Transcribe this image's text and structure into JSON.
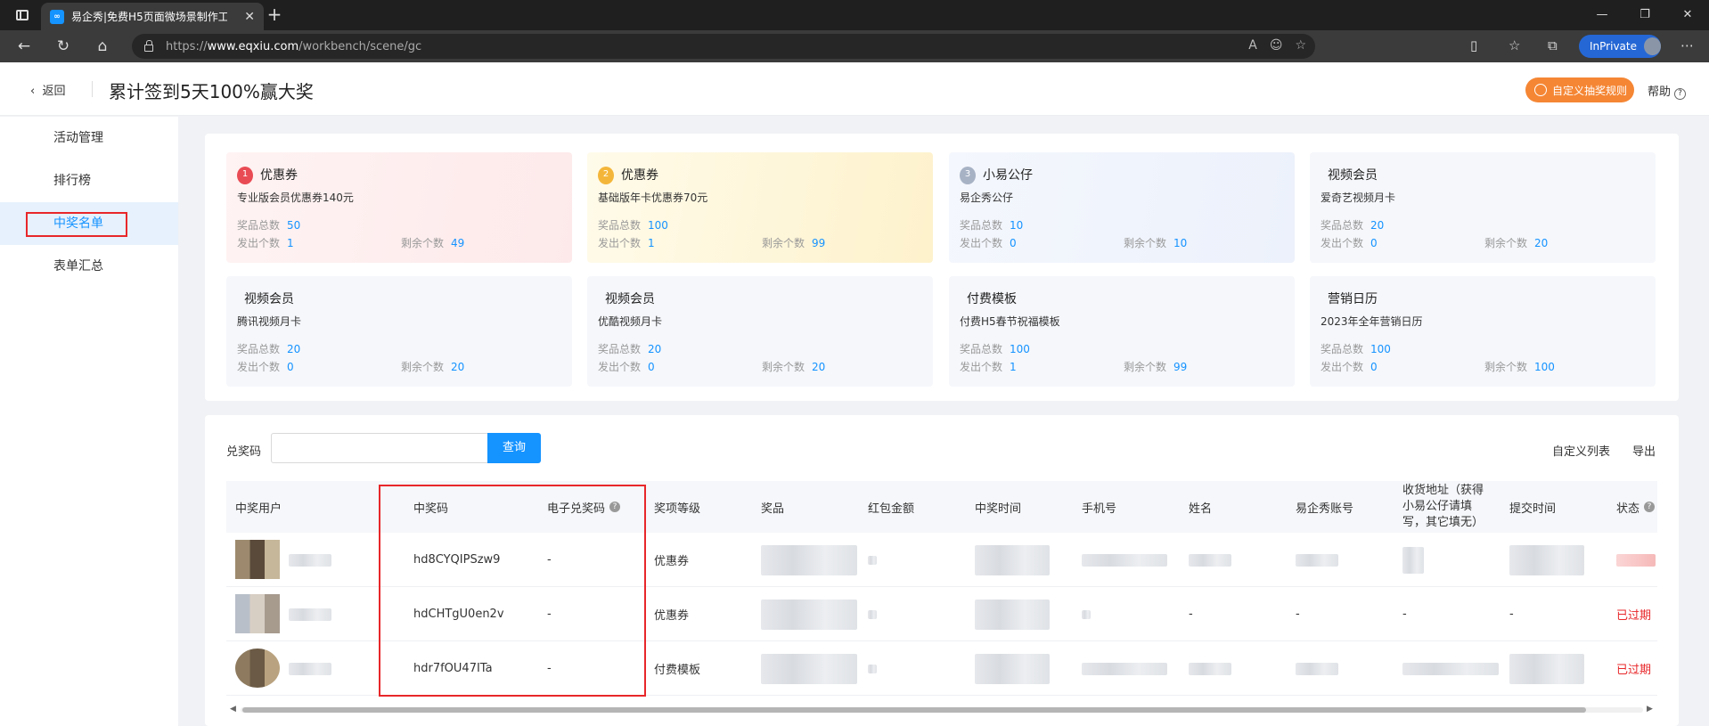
{
  "browser": {
    "tab_title": "易企秀|免费H5页面微场景制作工",
    "url_prefix": "https://",
    "url_domain": "www.eqxiu.com",
    "url_path": "/workbench/scene/gc",
    "inprivate": "InPrivate"
  },
  "header": {
    "back": "返回",
    "title": "累计签到5天100%赢大奖",
    "rule_button": "自定义抽奖规则",
    "help": "帮助"
  },
  "sidebar": {
    "items": [
      "活动管理",
      "排行榜",
      "中奖名单",
      "表单汇总"
    ]
  },
  "prize_labels": {
    "total": "奖品总数",
    "issued": "发出个数",
    "remaining": "剩余个数"
  },
  "prizes": [
    {
      "rank": "1",
      "name": "优惠券",
      "desc": "专业版会员优惠券140元",
      "total": "50",
      "issued": "1",
      "remaining": "49"
    },
    {
      "rank": "2",
      "name": "优惠券",
      "desc": "基础版年卡优惠券70元",
      "total": "100",
      "issued": "1",
      "remaining": "99"
    },
    {
      "rank": "3",
      "name": "小易公仔",
      "desc": "易企秀公仔",
      "total": "10",
      "issued": "0",
      "remaining": "10"
    },
    {
      "rank": "",
      "name": "视频会员",
      "desc": "爱奇艺视频月卡",
      "total": "20",
      "issued": "0",
      "remaining": "20"
    },
    {
      "rank": "",
      "name": "视频会员",
      "desc": "腾讯视频月卡",
      "total": "20",
      "issued": "0",
      "remaining": "20"
    },
    {
      "rank": "",
      "name": "视频会员",
      "desc": "优酷视频月卡",
      "total": "20",
      "issued": "0",
      "remaining": "20"
    },
    {
      "rank": "",
      "name": "付费模板",
      "desc": "付费H5春节祝福模板",
      "total": "100",
      "issued": "1",
      "remaining": "99"
    },
    {
      "rank": "",
      "name": "营销日历",
      "desc": "2023年全年营销日历",
      "total": "100",
      "issued": "0",
      "remaining": "100"
    }
  ],
  "search": {
    "label": "兑奖码",
    "button": "查询",
    "placeholder": ""
  },
  "table_actions": {
    "custom_columns": "自定义列表",
    "export": "导出"
  },
  "table": {
    "columns": [
      "中奖用户",
      "中奖码",
      "电子兑奖码",
      "奖项等级",
      "奖品",
      "红包金额",
      "中奖时间",
      "手机号",
      "姓名",
      "易企秀账号",
      "收货地址（获得小易公仔请填写，其它填无）",
      "提交时间",
      "状态"
    ],
    "rows": [
      {
        "code": "hd8CYQIPSzw9",
        "ecode": "-",
        "level": "优惠券",
        "phone": "",
        "name": "",
        "account": "",
        "address": "",
        "submit": "",
        "status": ""
      },
      {
        "code": "hdCHTgU0en2v",
        "ecode": "-",
        "level": "优惠券",
        "phone": "",
        "name": "-",
        "account": "-",
        "address": "-",
        "submit": "-",
        "status": "已过期"
      },
      {
        "code": "hdr7fOU47ITa",
        "ecode": "-",
        "level": "付费模板",
        "phone": "",
        "name": "",
        "account": "",
        "address": "",
        "submit": "",
        "status": "已过期"
      }
    ]
  },
  "colors": {
    "accent": "#1593ff",
    "highlight": "#e8272a",
    "orange": "#f58634"
  }
}
